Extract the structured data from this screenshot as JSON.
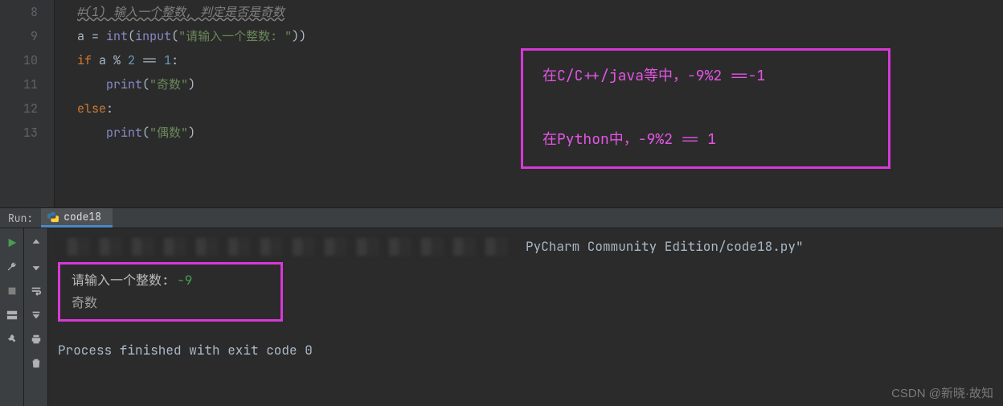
{
  "editor": {
    "line_numbers": [
      "8",
      "9",
      "10",
      "11",
      "12",
      "13"
    ],
    "lines": {
      "l8_comment": "#(1) 输入一个整数, 判定是否是奇数",
      "l9_a": "a ",
      "l9_eq": "= ",
      "l9_int": "int",
      "l9_input": "input",
      "l9_str": "\"请输入一个整数: \"",
      "l10_if": "if ",
      "l10_expr": "a % ",
      "l10_2": "2",
      "l10_eqeq": " == ",
      "l10_1": "1",
      "l10_colon": ":",
      "l11_print": "print",
      "l11_str": "\"奇数\"",
      "l12_else": "else",
      "l12_colon": ":",
      "l13_print": "print",
      "l13_str": "\"偶数\""
    }
  },
  "annotation": {
    "line1": "在C/C++/java等中，-9%2 ==-1",
    "line2": "在Python中，-9%2 == 1"
  },
  "run_panel": {
    "label": "Run:",
    "tab_name": "code18",
    "path_suffix": "PyCharm Community Edition/code18.py\"",
    "prompt": "请输入一个整数: ",
    "user_input": "-9",
    "output": "奇数",
    "exit_msg": "Process finished with exit code 0"
  },
  "watermark": "CSDN @新晓·故知"
}
